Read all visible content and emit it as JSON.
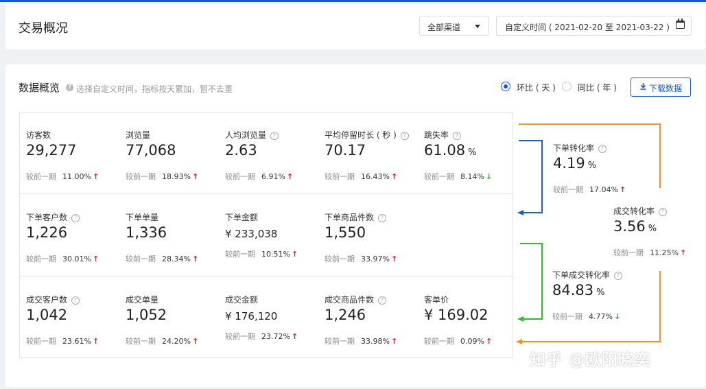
{
  "header": {
    "title": "交易概况",
    "channel": "全部渠道",
    "date_range": "自定义时间 ( 2021-02-20 至 2021-03-22 )"
  },
  "overview": {
    "title": "数据概览",
    "hint": "选择自定义时间，指标按天累加，暂不去重",
    "radio_mom": "环比 ( 天 )",
    "radio_yoy": "同比 ( 年 )",
    "download": "下载数据",
    "compare_label": "较前一期"
  },
  "metrics": [
    {
      "label": "访客数",
      "value": "29,277",
      "change": "11.00%",
      "dir": "up"
    },
    {
      "label": "浏览量",
      "value": "77,068",
      "change": "18.93%",
      "dir": "up"
    },
    {
      "label": "人均浏览量",
      "value": "2.63",
      "change": "6.91%",
      "dir": "up"
    },
    {
      "label": "平均停留时长 ( 秒 )",
      "value": "70.17",
      "change": "16.43%",
      "dir": "up"
    },
    {
      "label": "跳失率",
      "value": "61.08",
      "unit": "%",
      "change": "8.14%",
      "dir": "down"
    },
    {
      "label": "下单客户数",
      "value": "1,226",
      "change": "30.01%",
      "dir": "up"
    },
    {
      "label": "下单单量",
      "value": "1,336",
      "change": "28.34%",
      "dir": "up"
    },
    {
      "label": "下单金额",
      "value": "¥ 233,038",
      "change": "10.51%",
      "dir": "up"
    },
    {
      "label": "下单商品件数",
      "value": "1,550",
      "change": "33.97%",
      "dir": "up"
    },
    {
      "label": "成交客户数",
      "value": "1,042",
      "change": "23.61%",
      "dir": "up"
    },
    {
      "label": "成交单量",
      "value": "1,052",
      "change": "24.20%",
      "dir": "up"
    },
    {
      "label": "成交金额",
      "value": "¥ 176,120",
      "change": "23.72%",
      "dir": "up"
    },
    {
      "label": "成交商品件数",
      "value": "1,246",
      "change": "33.98%",
      "dir": "up"
    },
    {
      "label": "客单价",
      "value": "¥ 169.02",
      "change": "0.09%",
      "dir": "up"
    }
  ],
  "funnel": [
    {
      "label": "下单转化率",
      "value": "4.19",
      "unit": "%",
      "change": "17.04%",
      "dir": "up"
    },
    {
      "label": "成交转化率",
      "value": "3.56",
      "unit": "%",
      "change": "11.25%",
      "dir": "up"
    },
    {
      "label": "下单成交转化率",
      "value": "84.83",
      "unit": "%",
      "change": "4.77%",
      "dir": "up"
    }
  ],
  "colors": {
    "accent": "#1a56db",
    "up": "#d92121",
    "down": "#2ea52e",
    "orange": "#f0912d",
    "blue": "#1f5fb5",
    "green": "#2dbe2d"
  },
  "watermark": "知乎 @欧阳晓奕"
}
